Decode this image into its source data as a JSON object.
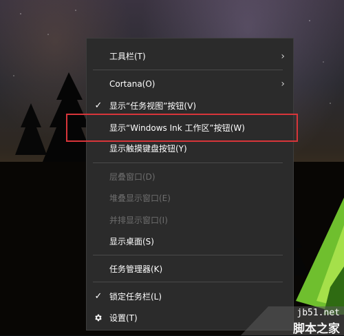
{
  "menu": {
    "items": [
      {
        "label": "工具栏(T)",
        "has_submenu": true,
        "checked": false,
        "disabled": false
      },
      {
        "label": "Cortana(O)",
        "has_submenu": true,
        "checked": false,
        "disabled": false
      },
      {
        "label": "显示“任务视图”按钮(V)",
        "has_submenu": false,
        "checked": true,
        "disabled": false
      },
      {
        "label": "显示“Windows Ink 工作区”按钮(W)",
        "has_submenu": false,
        "checked": false,
        "disabled": false,
        "highlighted": true
      },
      {
        "label": "显示触摸键盘按钮(Y)",
        "has_submenu": false,
        "checked": false,
        "disabled": false
      },
      {
        "label": "层叠窗口(D)",
        "has_submenu": false,
        "checked": false,
        "disabled": true
      },
      {
        "label": "堆叠显示窗口(E)",
        "has_submenu": false,
        "checked": false,
        "disabled": true
      },
      {
        "label": "并排显示窗口(I)",
        "has_submenu": false,
        "checked": false,
        "disabled": true
      },
      {
        "label": "显示桌面(S)",
        "has_submenu": false,
        "checked": false,
        "disabled": false
      },
      {
        "label": "任务管理器(K)",
        "has_submenu": false,
        "checked": false,
        "disabled": false
      },
      {
        "label": "锁定任务栏(L)",
        "has_submenu": false,
        "checked": true,
        "disabled": false
      },
      {
        "label": "设置(T)",
        "has_submenu": false,
        "checked": false,
        "disabled": false,
        "icon": "gear-icon"
      }
    ],
    "check_glyph": "✓",
    "arrow_glyph": "›"
  },
  "colors": {
    "menu_background": "#2b2b2b",
    "highlight_box": "#d9353a",
    "disabled_text": "#6e6e6e"
  },
  "watermark": {
    "url": "jb51.net",
    "name": "脚本之家"
  }
}
